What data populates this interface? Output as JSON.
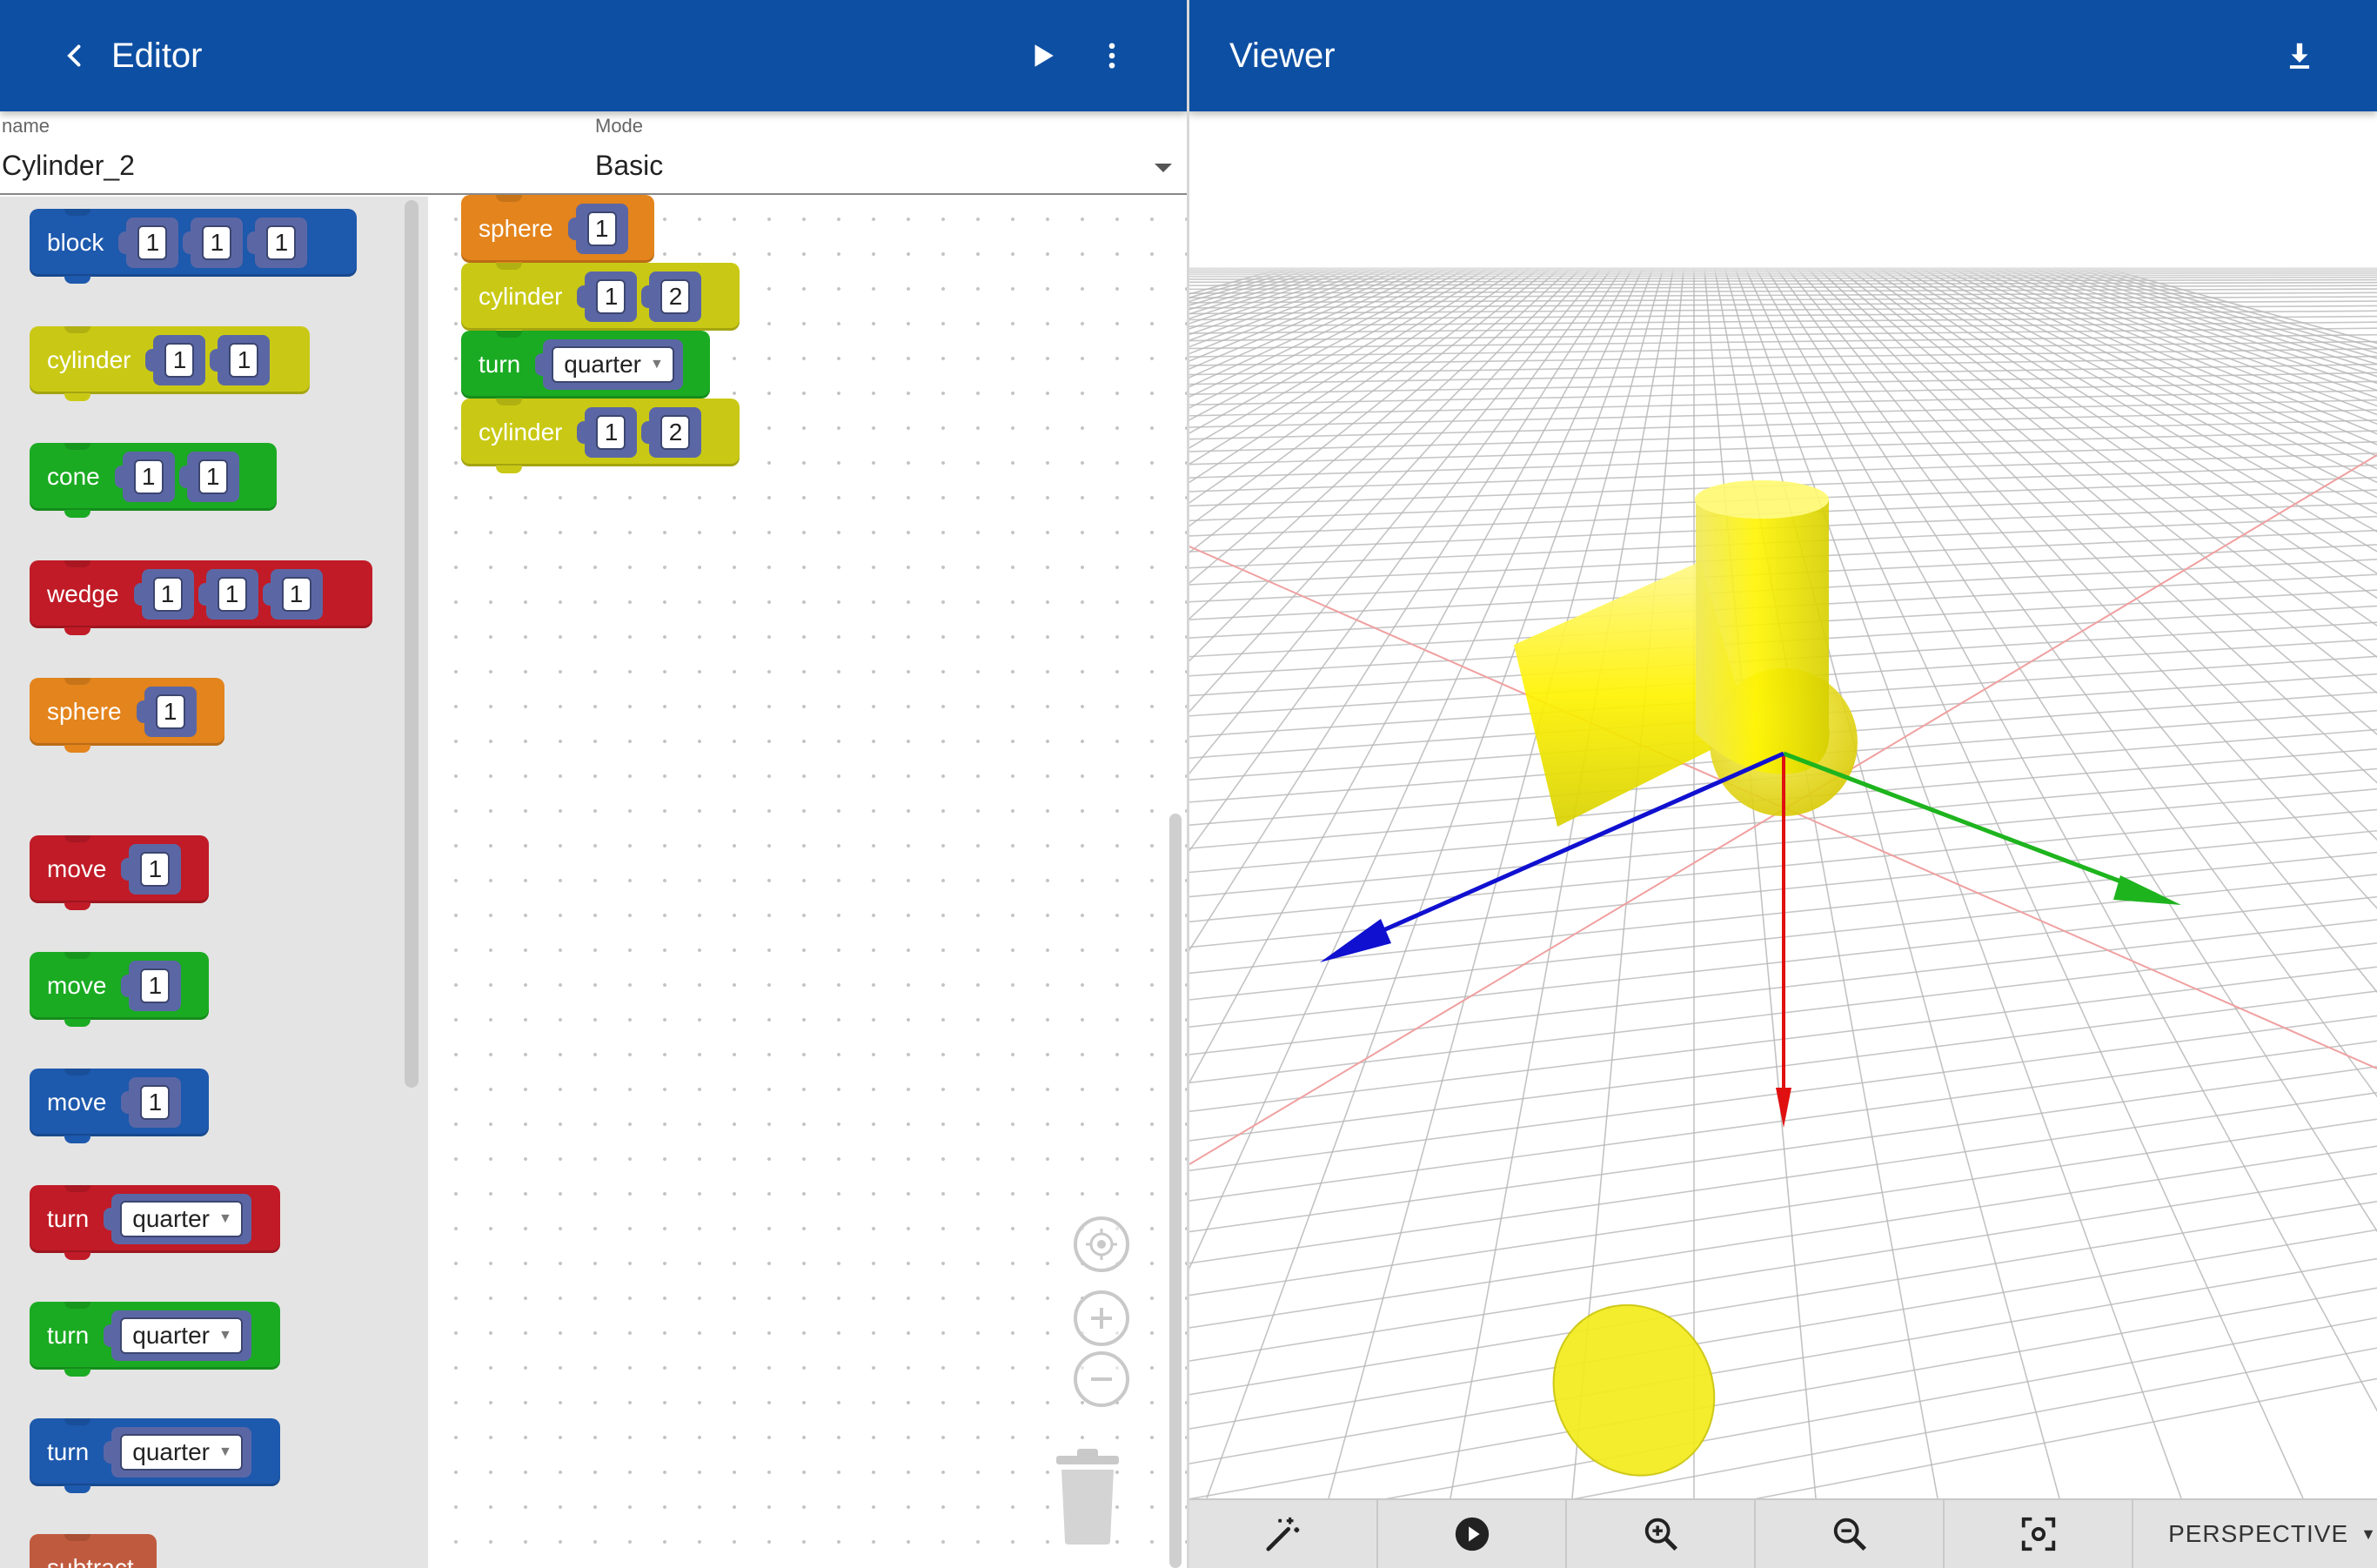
{
  "editor": {
    "title": "Editor"
  },
  "viewer": {
    "title": "Viewer"
  },
  "fields": {
    "name_label": "name",
    "name_value": "Cylinder_2",
    "mode_label": "Mode",
    "mode_value": "Basic"
  },
  "flyout": {
    "blocks": [
      {
        "label": "block",
        "color": "#1d59ad",
        "args": [
          "1",
          "1",
          "1"
        ]
      },
      {
        "label": "cylinder",
        "color": "#c9c915",
        "args": [
          "1",
          "1"
        ]
      },
      {
        "label": "cone",
        "color": "#1aab22",
        "args": [
          "1",
          "1"
        ]
      },
      {
        "label": "wedge",
        "color": "#c01b27",
        "args": [
          "1",
          "1",
          "1"
        ]
      },
      {
        "label": "sphere",
        "color": "#e3841c",
        "args": [
          "1"
        ]
      },
      {
        "label": "move",
        "color": "#c01b27",
        "args": [
          "1"
        ]
      },
      {
        "label": "move",
        "color": "#1aab22",
        "args": [
          "1"
        ]
      },
      {
        "label": "move",
        "color": "#1d59ad",
        "args": [
          "1"
        ]
      },
      {
        "label": "turn",
        "color": "#c01b27",
        "dropdown": "quarter"
      },
      {
        "label": "turn",
        "color": "#1aab22",
        "dropdown": "quarter"
      },
      {
        "label": "turn",
        "color": "#1d59ad",
        "dropdown": "quarter"
      },
      {
        "label": "subtract",
        "color": "#c05a3e"
      }
    ]
  },
  "workspace": {
    "blocks": [
      {
        "label": "sphere",
        "color": "#e3841c",
        "args": [
          "1"
        ]
      },
      {
        "label": "cylinder",
        "color": "#c9c915",
        "args": [
          "1",
          "2"
        ]
      },
      {
        "label": "turn",
        "color": "#1aab22",
        "dropdown": "quarter"
      },
      {
        "label": "cylinder",
        "color": "#c9c915",
        "args": [
          "1",
          "2"
        ]
      }
    ]
  },
  "toolbar": {
    "camera_mode": "PERSPECTIVE"
  },
  "colors": {
    "header": "#0d4fa3",
    "axis_x": "#e01010",
    "axis_y": "#1eb41e",
    "axis_z": "#1010d0",
    "shape": "#f5f000"
  }
}
